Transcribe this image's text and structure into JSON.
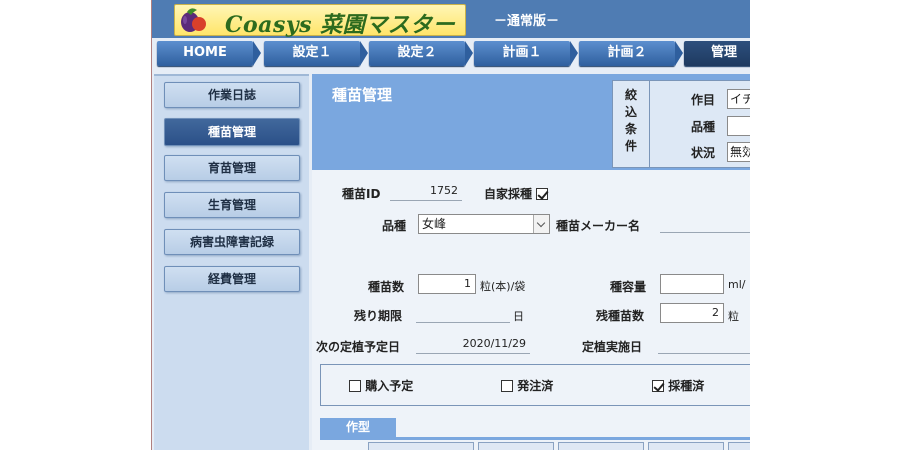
{
  "header": {
    "logo_text": "Coasys 菜園マスター",
    "edition": "－通常版－"
  },
  "nav": {
    "tabs": [
      {
        "label": "HOME"
      },
      {
        "label": "設定１"
      },
      {
        "label": "設定２"
      },
      {
        "label": "計画１"
      },
      {
        "label": "計画２"
      },
      {
        "label": "管理"
      }
    ],
    "active": "管理"
  },
  "sidebar": {
    "items": [
      {
        "label": "作業日誌"
      },
      {
        "label": "種苗管理"
      },
      {
        "label": "育苗管理"
      },
      {
        "label": "生育管理"
      },
      {
        "label": "病害虫障害記録"
      },
      {
        "label": "経費管理"
      }
    ],
    "active": "種苗管理"
  },
  "main": {
    "title": "種苗管理",
    "filter": {
      "label": "絞込条件",
      "crop_label": "作目",
      "crop_value": "イチ",
      "variety_label": "品種",
      "variety_value": "",
      "status_label": "状況",
      "status_value": "無効"
    },
    "form": {
      "seed_id_label": "種苗ID",
      "seed_id_value": "1752",
      "home_seed_label": "自家採種",
      "home_seed_checked": true,
      "variety_label": "品種",
      "variety_value": "女峰",
      "maker_label": "種苗メーカー名",
      "maker_value": "",
      "seed_count_label": "種苗数",
      "seed_count_value": "1",
      "seed_count_unit": "粒(本)/袋",
      "volume_label": "種容量",
      "volume_value": "",
      "volume_unit": "ml/",
      "expiry_label": "残り期限",
      "expiry_value": "",
      "expiry_unit": "日",
      "remaining_label": "残種苗数",
      "remaining_value": "2",
      "remaining_unit": "粒",
      "planned_date_label": "次の定植予定日",
      "planned_date_value": "2020/11/29",
      "actual_date_label": "定植実施日",
      "actual_date_value": ""
    },
    "status": {
      "purchase_label": "購入予定",
      "purchase_checked": false,
      "ordered_label": "発注済",
      "ordered_checked": false,
      "collected_label": "採種済",
      "collected_checked": true
    },
    "cropping_tab_label": "作型"
  },
  "colors": {
    "header": "#4f7cb3",
    "title_bar": "#7aa7df",
    "nav_tab": "#2f5f9e",
    "sidebar_active": "#2b5088"
  }
}
